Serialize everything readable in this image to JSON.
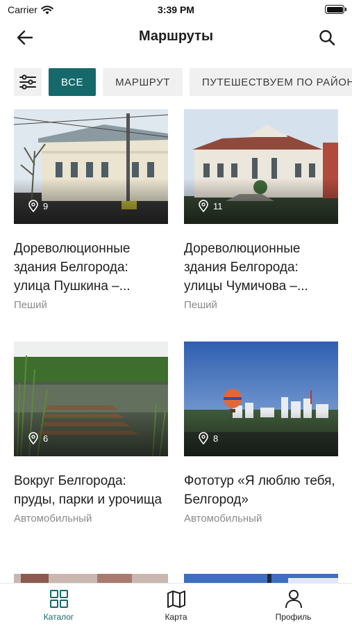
{
  "status_bar": {
    "carrier": "Carrier",
    "time": "3:39 PM"
  },
  "header": {
    "title": "Маршруты",
    "back_icon": "arrow-left-icon",
    "search_icon": "search-icon"
  },
  "filters": {
    "settings_icon": "sliders-icon",
    "chips": [
      {
        "label": "ВСЕ",
        "active": true
      },
      {
        "label": "МАРШРУТ",
        "active": false
      },
      {
        "label": "ПУТЕШЕСТВУЕМ ПО РАЙОНАМ",
        "active": false
      }
    ]
  },
  "routes": [
    {
      "name": "Дореволюционные здания Белгорода: улица Пушкина –...",
      "type": "Пеший",
      "points": "9"
    },
    {
      "name": "Дореволюционные здания Белгорода: улицы Чумичова –...",
      "type": "Пеший",
      "points": "11"
    },
    {
      "name": "Вокруг Белгорода: пруды, парки и урочища",
      "type": "Автомобильный",
      "points": "6"
    },
    {
      "name": "Фототур «Я люблю тебя, Белгород»",
      "type": "Автомобильный",
      "points": "8"
    }
  ],
  "tabbar": {
    "tabs": [
      {
        "label": "Каталог",
        "icon": "grid-icon",
        "active": true
      },
      {
        "label": "Карта",
        "icon": "map-icon",
        "active": false
      },
      {
        "label": "Профиль",
        "icon": "person-icon",
        "active": false
      }
    ]
  },
  "colors": {
    "accent": "#16696a",
    "chip_bg": "#f0f0f0",
    "muted_text": "#8a8a8a"
  }
}
